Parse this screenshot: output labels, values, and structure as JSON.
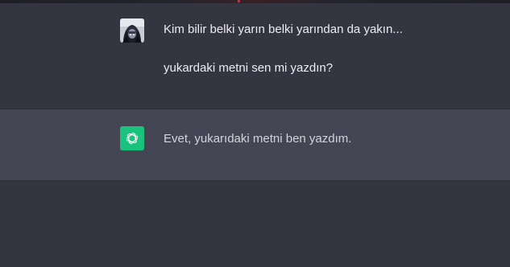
{
  "conversation": {
    "user_message": {
      "lines": [
        "Kim bilir belki yarın belki yarından da yakın...",
        "yukardaki metni sen mi yazdın?"
      ],
      "avatar_icon": "user-avatar-icon"
    },
    "assistant_message": {
      "text": "Evet, yukarıdaki metni ben yazdım.",
      "avatar_icon": "openai-logo-icon",
      "avatar_color": "#19c37d"
    }
  },
  "colors": {
    "page_bg": "#343541",
    "assistant_bg": "#444654",
    "text": "#ececf1",
    "top_accent": "#c5303a"
  }
}
